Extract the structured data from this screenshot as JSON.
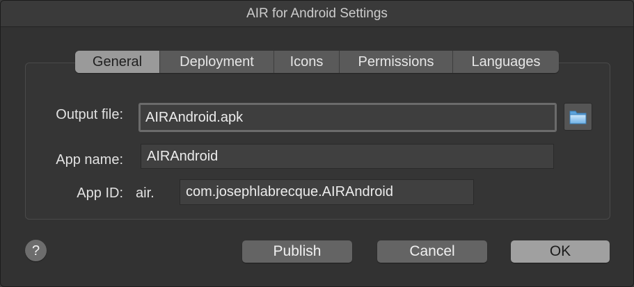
{
  "window": {
    "title": "AIR for Android Settings"
  },
  "tabs": [
    {
      "label": "General",
      "active": true
    },
    {
      "label": "Deployment",
      "active": false
    },
    {
      "label": "Icons",
      "active": false
    },
    {
      "label": "Permissions",
      "active": false
    },
    {
      "label": "Languages",
      "active": false
    }
  ],
  "general": {
    "output_file_label": "Output file:",
    "output_file_value": "AIRAndroid.apk",
    "app_name_label": "App name:",
    "app_name_value": "AIRAndroid",
    "app_id_label": "App ID:",
    "app_id_prefix": "air.",
    "app_id_value": "com.josephlabrecque.AIRAndroid",
    "browse_icon": "folder-icon"
  },
  "footer": {
    "help_label": "?",
    "publish_label": "Publish",
    "cancel_label": "Cancel",
    "ok_label": "OK"
  },
  "colors": {
    "dialog_bg": "#323232",
    "active_tab": "#9a9a9a",
    "primary_button": "#a0a0a0"
  }
}
